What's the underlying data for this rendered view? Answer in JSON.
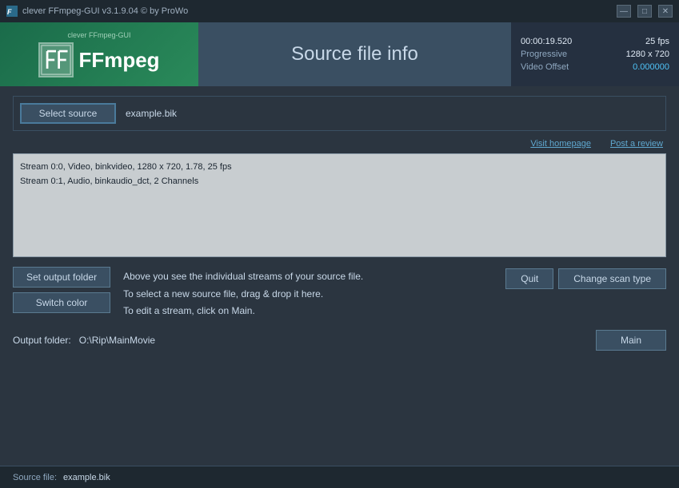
{
  "titlebar": {
    "title": "clever FFmpeg-GUI v3.1.9.04   © by ProWo",
    "minimize": "—",
    "maximize": "□",
    "close": "✕"
  },
  "header": {
    "logo_brand": "clever FFmpeg-GUI",
    "logo_text": "FFmpeg",
    "logo_icon": "FF",
    "source_title": "Source file info",
    "info": {
      "duration": "00:00:19.520",
      "fps": "25 fps",
      "scan": "Progressive",
      "resolution": "1280 x 720",
      "offset_label": "Video Offset",
      "offset_value": "0.000000"
    }
  },
  "select_row": {
    "button_label": "Select source",
    "file_name": "example.bik"
  },
  "links": {
    "visit": "Visit homepage",
    "review": "Post a review"
  },
  "streams": {
    "line1": "Stream 0:0, Video, binkvideo, 1280 x 720, 1.78, 25 fps",
    "line2": "Stream 0:1, Audio, binkaudio_dct, 2 Channels"
  },
  "instructions": {
    "line1": "Above you see the individual streams of your source file.",
    "line2": "To select a new source file, drag & drop it here.",
    "line3": "To edit a stream, click on Main."
  },
  "buttons": {
    "set_output": "Set output folder",
    "switch_color": "Switch color",
    "quit": "Quit",
    "change_scan": "Change scan type",
    "main": "Main"
  },
  "output": {
    "label": "Output folder:",
    "path": "O:\\Rip\\MainMovie"
  },
  "status": {
    "label": "Source file:",
    "file": "example.bik"
  },
  "colors": {
    "accent": "#4fc3f7",
    "brand_green": "#2a8a5a"
  }
}
